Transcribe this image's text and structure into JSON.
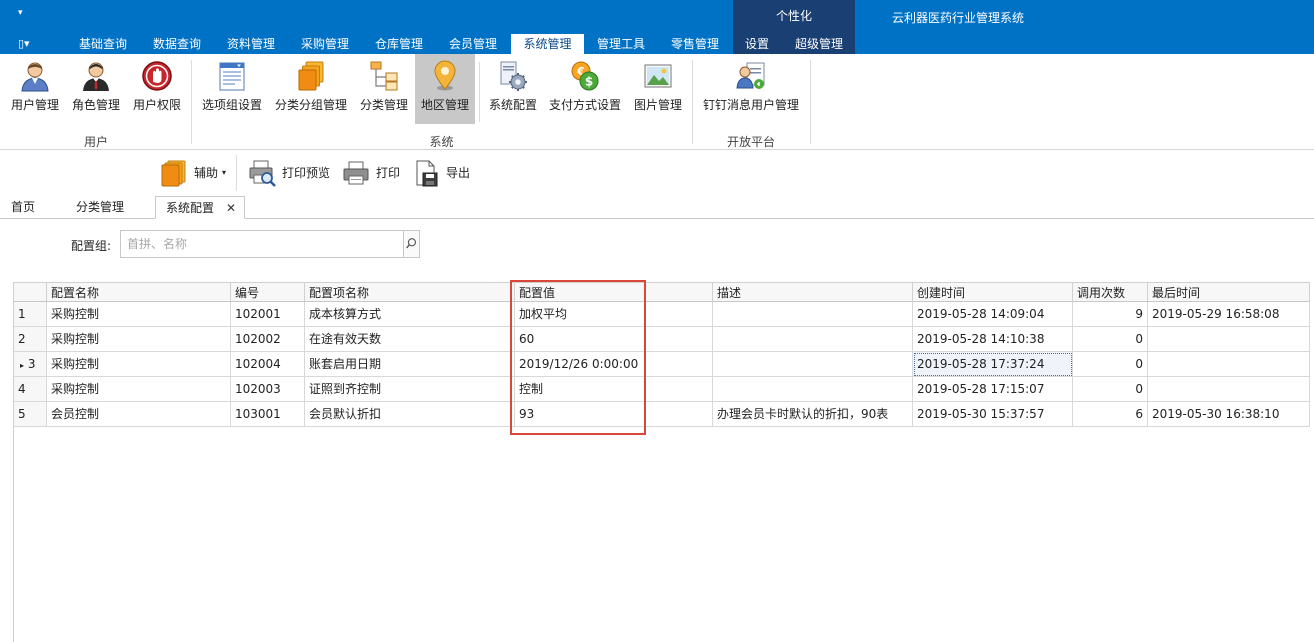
{
  "titlebar": {
    "qat_glyph": "▾",
    "app_title": "云利器医药行业管理系统",
    "context_group_label": "个性化",
    "app_menu_glyph": "▯▾",
    "tabs": [
      {
        "label": "基础查询"
      },
      {
        "label": "数据查询"
      },
      {
        "label": "资料管理"
      },
      {
        "label": "采购管理"
      },
      {
        "label": "仓库管理"
      },
      {
        "label": "会员管理"
      },
      {
        "label": "系统管理"
      },
      {
        "label": "管理工具"
      },
      {
        "label": "零售管理"
      },
      {
        "label": "设置"
      },
      {
        "label": "超级管理"
      }
    ]
  },
  "ribbon": {
    "groups": [
      {
        "label": "用户"
      },
      {
        "label": "系统"
      },
      {
        "label": "开放平台"
      }
    ],
    "buttons": [
      {
        "label": "用户管理",
        "icon": "user-icon"
      },
      {
        "label": "角色管理",
        "icon": "role-icon"
      },
      {
        "label": "用户权限",
        "icon": "permission-icon"
      },
      {
        "label": "选项组设置",
        "icon": "option-group-icon"
      },
      {
        "label": "分类分组管理",
        "icon": "category-group-icon"
      },
      {
        "label": "分类管理",
        "icon": "category-tree-icon"
      },
      {
        "label": "地区管理",
        "icon": "location-pin-icon"
      },
      {
        "label": "系统配置",
        "icon": "system-config-icon"
      },
      {
        "label": "支付方式设置",
        "icon": "payment-icon"
      },
      {
        "label": "图片管理",
        "icon": "picture-icon"
      },
      {
        "label": "钉钉消息用户管理",
        "icon": "dingtalk-user-icon"
      }
    ]
  },
  "toolbar": {
    "assist_label": "辅助",
    "assist_arrow": "▾",
    "print_preview_label": "打印预览",
    "print_label": "打印",
    "export_label": "导出"
  },
  "doc_tabs": {
    "items": [
      {
        "label": "首页"
      },
      {
        "label": "分类管理"
      },
      {
        "label": "系统配置"
      }
    ],
    "close_glyph": "✕"
  },
  "filter": {
    "label": "配置组:",
    "placeholder": "首拼、名称",
    "value": ""
  },
  "grid": {
    "columns": [
      "配置名称",
      "编号",
      "配置项名称",
      "配置值",
      "描述",
      "创建时间",
      "调用次数",
      "最后时间"
    ],
    "rows": [
      {
        "ind": "1",
        "cells": [
          "采购控制",
          "102001",
          "成本核算方式",
          "加权平均",
          "",
          "2019-05-28 14:09:04",
          "9",
          "2019-05-29 16:58:08"
        ]
      },
      {
        "ind": "2",
        "cells": [
          "采购控制",
          "102002",
          "在途有效天数",
          "60",
          "",
          "2019-05-28 14:10:38",
          "0",
          ""
        ]
      },
      {
        "ind": "3",
        "cells": [
          "采购控制",
          "102004",
          "账套启用日期",
          "2019/12/26 0:00:00",
          "",
          "2019-05-28 17:37:24",
          "0",
          ""
        ]
      },
      {
        "ind": "4",
        "cells": [
          "采购控制",
          "102003",
          "证照到齐控制",
          "控制",
          "",
          "2019-05-28 17:15:07",
          "0",
          ""
        ]
      },
      {
        "ind": "5",
        "cells": [
          "会员控制",
          "103001",
          "会员默认折扣",
          "93",
          "办理会员卡时默认的折扣，90表",
          "2019-05-30 15:37:57",
          "6",
          "2019-05-30 16:38:10"
        ]
      }
    ],
    "current_row_marker": "▸",
    "highlight_color": "#d9463a"
  },
  "colors": {
    "titlebar_bg": "#0072c6",
    "context_group_bg": "#1a3f73",
    "selected_ribbon_bg": "#c8c8c8"
  }
}
